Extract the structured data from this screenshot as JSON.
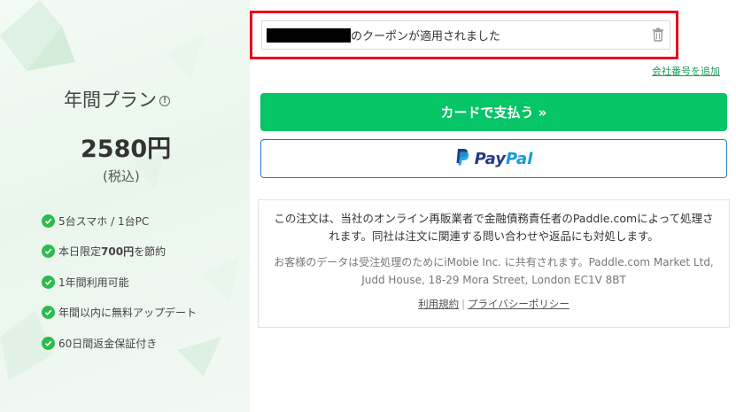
{
  "plan": {
    "title": "年間プラン",
    "info_icon": "info-icon",
    "price": "2580円",
    "tax_note": "(税込)"
  },
  "features": [
    {
      "prefix": "5台スマホ / 1台PC",
      "bold": "",
      "suffix": ""
    },
    {
      "prefix": "本日限定",
      "bold": "700円",
      "suffix": "を節約"
    },
    {
      "prefix": "1年間利用可能",
      "bold": "",
      "suffix": ""
    },
    {
      "prefix": "年間以内に無料アップデート",
      "bold": "",
      "suffix": ""
    },
    {
      "prefix": "60日間返金保証付き",
      "bold": "",
      "suffix": ""
    }
  ],
  "coupon": {
    "applied_text": "のクーポンが適用されました",
    "remove_icon": "trash-icon"
  },
  "company_number_link": "会社番号を追加",
  "pay_card_button": "カードで支払う »",
  "paypal_button": {
    "part1": "Pay",
    "part2": "Pal"
  },
  "notice": {
    "main": "この注文は、当社のオンライン再販業者で金融債務責任者のPaddle.comによって処理されます。同社は注文に関連する問い合わせや返品にも対処します。",
    "sub": "お客様のデータは受注処理のためにiMobie Inc. に共有されます。Paddle.com Market Ltd, Judd House, 18-29 Mora Street, London EC1V 8BT",
    "terms_link": "利用規約",
    "separator": "|",
    "privacy_link": "プライバシーポリシー"
  },
  "colors": {
    "accent_green": "#05c567",
    "highlight_red": "#e8001c",
    "paypal_dark": "#253b80",
    "paypal_light": "#179bd7"
  }
}
